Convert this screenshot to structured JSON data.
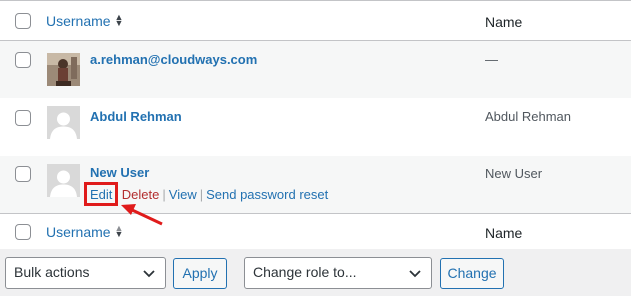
{
  "table": {
    "header": {
      "username_label": "Username",
      "name_label": "Name"
    },
    "footer": {
      "username_label": "Username",
      "name_label": "Name"
    },
    "rows": [
      {
        "username": "a.rehman@cloudways.com",
        "name": "—",
        "avatar": "photo"
      },
      {
        "username": "Abdul Rehman",
        "name": "Abdul Rehman",
        "avatar": "default"
      },
      {
        "username": "New User",
        "name": "New User",
        "avatar": "default",
        "actions": {
          "edit": "Edit",
          "delete": "Delete",
          "view": "View",
          "reset": "Send password reset"
        }
      }
    ]
  },
  "bulk_bar": {
    "bulk_actions": "Bulk actions",
    "apply": "Apply",
    "change_role": "Change role to...",
    "change": "Change"
  },
  "colors": {
    "link": "#2271b1",
    "delete": "#b32d2e",
    "highlight": "#e01b1b"
  }
}
